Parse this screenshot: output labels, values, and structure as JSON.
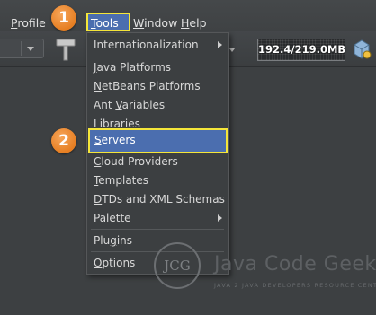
{
  "menubar": {
    "profile": {
      "label": "Profile",
      "mnemonic": "P",
      "rest": "rofile"
    },
    "tools": {
      "label": "Tools",
      "mnemonic": "T",
      "rest": "ools"
    },
    "window": {
      "label": "Window",
      "mnemonic": "W",
      "rest": "indow"
    },
    "help": {
      "label": "Help",
      "mnemonic": "H",
      "rest": "elp"
    }
  },
  "toolbar": {
    "memory": "192.4/219.0MB",
    "memory_used_fraction": 0.879
  },
  "tools_menu": {
    "items": [
      {
        "label": "Internationalization",
        "submenu": true
      },
      {
        "label": "Java Platforms",
        "mnemonic": "J",
        "rest": "ava Platforms"
      },
      {
        "label": "NetBeans Platforms",
        "mnemonic": "N",
        "rest": "etBeans Platforms"
      },
      {
        "label": "Ant Variables",
        "pre": "Ant ",
        "mnemonic": "V",
        "rest": "ariables"
      },
      {
        "label": "Libraries",
        "mnemonic": "L",
        "rest": "ibraries"
      },
      {
        "label": "Servers",
        "mnemonic": "S",
        "rest": "ervers",
        "selected": true
      },
      {
        "label": "Cloud Providers",
        "mnemonic": "C",
        "rest": "loud Providers"
      },
      {
        "label": "Templates",
        "mnemonic": "T",
        "rest": "emplates"
      },
      {
        "label": "DTDs and XML Schemas",
        "mnemonic": "D",
        "rest": "TDs and XML Schemas"
      },
      {
        "label": "Palette",
        "mnemonic": "P",
        "rest": "alette",
        "submenu": true
      },
      {
        "label": "Plugins",
        "mnemonic": "g",
        "pre": "Plu",
        "rest": "ins"
      },
      {
        "label": "Options",
        "mnemonic": "O",
        "rest": "ptions"
      }
    ]
  },
  "annotations": {
    "step1": "1",
    "step2": "2"
  },
  "watermark": {
    "monogram": "JCG",
    "name": "Java Code Geeks",
    "tagline": "JAVA 2 JAVA DEVELOPERS RESOURCE CENTER"
  },
  "colors": {
    "selection": "#4b6eaf",
    "highlight_border": "#f5e63a",
    "badge": "#e67e22"
  }
}
